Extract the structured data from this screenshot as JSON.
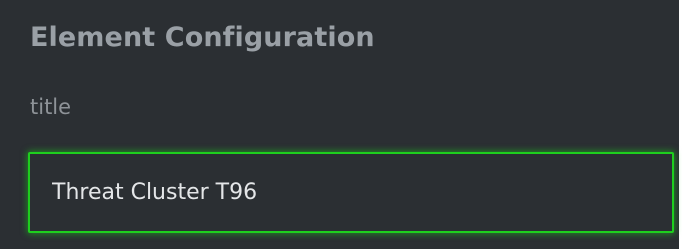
{
  "panel": {
    "title": "Element Configuration"
  },
  "fields": {
    "title": {
      "label": "title",
      "value": "Threat Cluster T96"
    }
  },
  "colors": {
    "panel_background": "#2b2f33",
    "heading_text": "#9aa0a6",
    "label_text": "#8e9398",
    "input_text": "#e4e6e8",
    "focus_border": "#1ecf1e"
  }
}
